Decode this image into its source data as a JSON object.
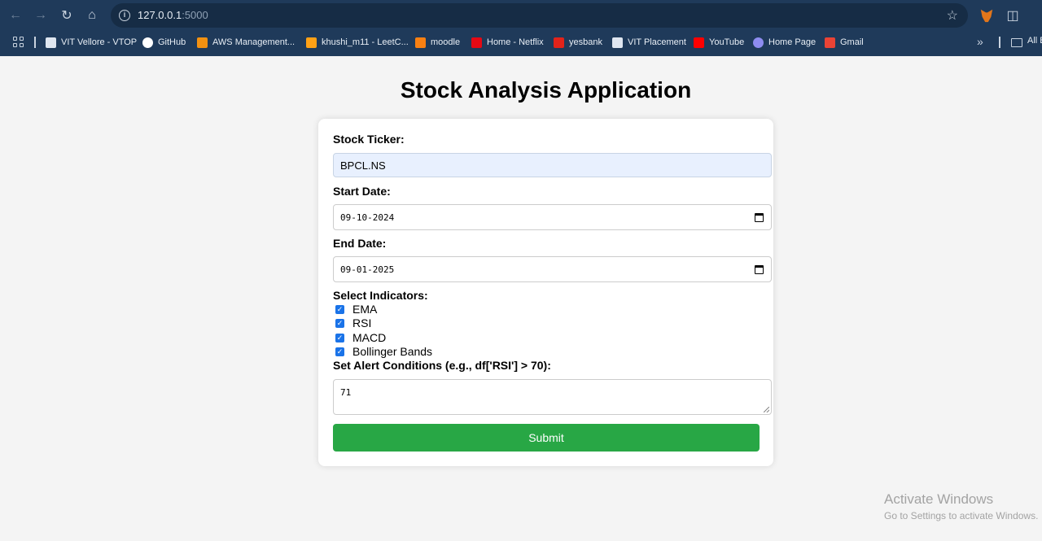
{
  "browser": {
    "url_host": "127.0.0.1",
    "url_port": ":5000",
    "bookmarks": [
      {
        "label": "VIT Vellore - VTOP",
        "color": "#dfe6f0"
      },
      {
        "label": "GitHub",
        "color": "#ffffff"
      },
      {
        "label": "AWS Management...",
        "color": "#f29111"
      },
      {
        "label": "khushi_m11 - LeetC...",
        "color": "#ffa116"
      },
      {
        "label": "moodle",
        "color": "#f98012"
      },
      {
        "label": "Home - Netflix",
        "color": "#e50914"
      },
      {
        "label": "yesbank",
        "color": "#e2231a"
      },
      {
        "label": "VIT Placement",
        "color": "#dfe6f0"
      },
      {
        "label": "YouTube",
        "color": "#ff0000"
      },
      {
        "label": "Home Page",
        "color": "#8e8cf0"
      },
      {
        "label": "Gmail",
        "color": "#ea4335"
      }
    ],
    "all_bookmarks_label": "All B"
  },
  "page": {
    "title": "Stock Analysis Application"
  },
  "form": {
    "ticker_label": "Stock Ticker:",
    "ticker_value": "BPCL.NS",
    "start_label": "Start Date:",
    "start_value": "09-10-2024",
    "end_label": "End Date:",
    "end_value": "09-01-2025",
    "indicators_label": "Select Indicators:",
    "indicators": [
      {
        "label": "EMA",
        "checked": true
      },
      {
        "label": "RSI",
        "checked": true
      },
      {
        "label": "MACD",
        "checked": true
      },
      {
        "label": "Bollinger Bands",
        "checked": true
      }
    ],
    "alert_label": "Set Alert Conditions (e.g., df['RSI'] > 70):",
    "alert_value": "71",
    "submit_label": "Submit",
    "accent_color": "#28a745"
  },
  "watermark": {
    "line1": "Activate Windows",
    "line2": "Go to Settings to activate Windows."
  }
}
